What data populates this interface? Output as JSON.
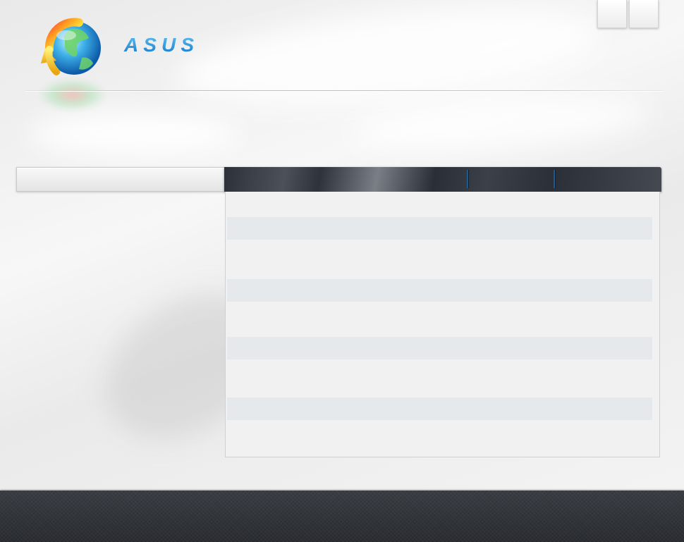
{
  "header": {
    "brand_text": "ASUS"
  },
  "window_controls": {
    "buttons": [
      "minimize",
      "close"
    ]
  },
  "icons": {
    "app_logo": "globe-update-icon"
  },
  "colors": {
    "brand_blue": "#1e8fd8",
    "table_header_dark": "#2f333b",
    "row_stripe": "#e6e9eb",
    "footer_bg": "#2f3338"
  },
  "table": {
    "columns": [
      "",
      "",
      ""
    ],
    "rows": [
      {
        "cells": [
          "",
          "",
          ""
        ]
      },
      {
        "cells": [
          "",
          "",
          ""
        ]
      },
      {
        "cells": [
          "",
          "",
          ""
        ]
      },
      {
        "cells": [
          "",
          "",
          ""
        ]
      },
      {
        "cells": [
          "",
          "",
          ""
        ]
      },
      {
        "cells": [
          "",
          "",
          ""
        ]
      },
      {
        "cells": [
          "",
          "",
          ""
        ]
      },
      {
        "cells": [
          "",
          "",
          ""
        ]
      },
      {
        "cells": [
          "",
          "",
          ""
        ]
      },
      {
        "cells": [
          "",
          "",
          ""
        ]
      },
      {
        "cells": [
          "",
          "",
          ""
        ]
      }
    ]
  }
}
